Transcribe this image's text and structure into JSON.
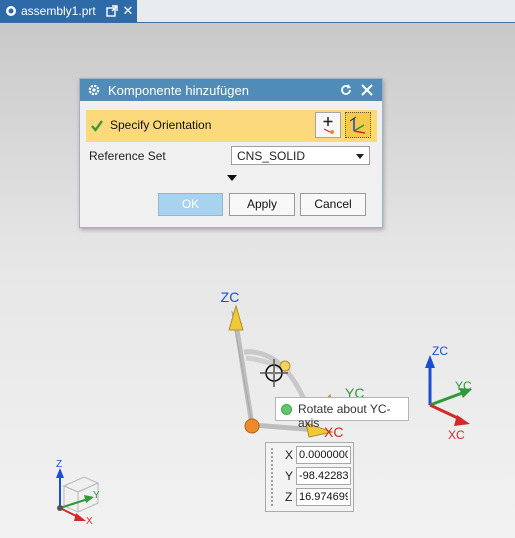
{
  "tab": {
    "label": "assembly1.prt",
    "close_glyph": "✕"
  },
  "dialog": {
    "title": "Komponente hinzufügen",
    "selection_label": "Specify Orientation",
    "reference_set_label": "Reference Set",
    "reference_set_value": "CNS_SOLID",
    "ok_label": "OK",
    "apply_label": "Apply",
    "cancel_label": "Cancel"
  },
  "manipulator": {
    "zc_label": "ZC",
    "yc_label": "YC",
    "xc_label": "XC",
    "tooltip": "Rotate about YC-axis"
  },
  "coordinates": {
    "x_label": "X",
    "x_value": "0.0000000",
    "y_label": "Y",
    "y_value": "-98.42283",
    "z_label": "Z",
    "z_value": "16.974699"
  },
  "triad_right": {
    "zc": "ZC",
    "yc": "YC",
    "xc": "XC"
  },
  "triad_left": {
    "z": "Z",
    "y": "Y",
    "x": "X"
  },
  "colors": {
    "tab_active": "#2e6aa8",
    "dialog_title": "#4f8db8",
    "selection_highlight": "#fcd97a",
    "axis_z": "#1a4fd0",
    "axis_y": "#2e9a3a",
    "axis_x": "#d12a2a",
    "handle": "#f0c93a"
  }
}
